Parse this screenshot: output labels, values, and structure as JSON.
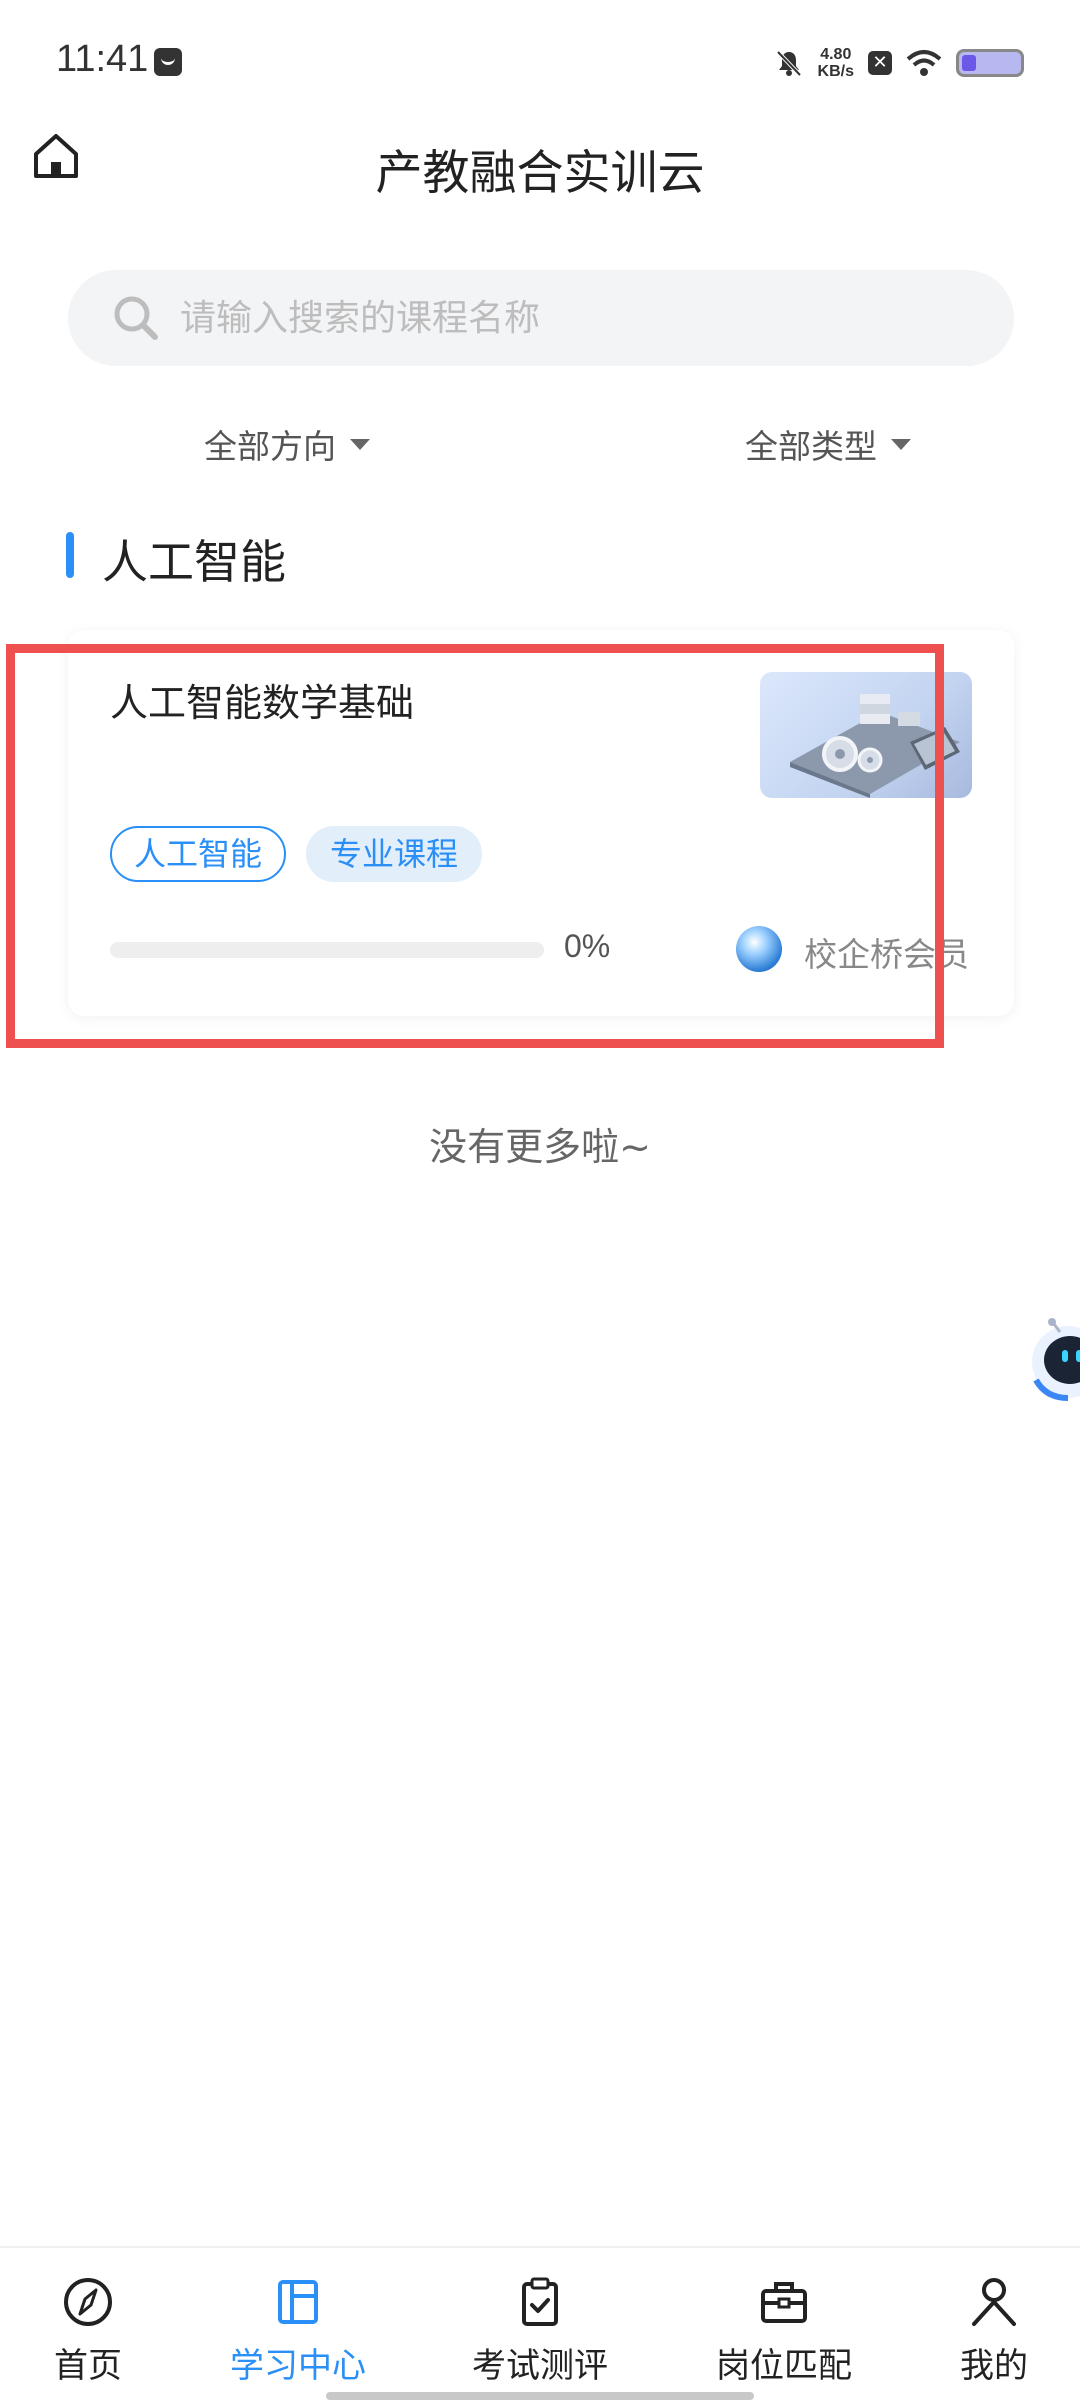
{
  "status_bar": {
    "time": "11:41",
    "net_speed_value": "4.80",
    "net_speed_unit": "KB/s"
  },
  "header": {
    "title": "产教融合实训云"
  },
  "search": {
    "placeholder": "请输入搜索的课程名称"
  },
  "filters": {
    "direction": "全部方向",
    "type": "全部类型"
  },
  "section": {
    "title": "人工智能"
  },
  "course": {
    "title": "人工智能数学基础",
    "tags": [
      "人工智能",
      "专业课程"
    ],
    "progress_text": "0%",
    "progress_value": 0,
    "provider": "校企桥会员"
  },
  "list_end_text": "没有更多啦~",
  "bottom_nav": [
    {
      "label": "首页",
      "icon": "compass-icon",
      "active": false
    },
    {
      "label": "学习中心",
      "icon": "book-layout-icon",
      "active": true
    },
    {
      "label": "考试测评",
      "icon": "clipboard-check-icon",
      "active": false
    },
    {
      "label": "岗位匹配",
      "icon": "briefcase-icon",
      "active": false
    },
    {
      "label": "我的",
      "icon": "person-icon",
      "active": false
    }
  ],
  "colors": {
    "accent": "#2a8ff7",
    "highlight": "#ee4f4f"
  }
}
